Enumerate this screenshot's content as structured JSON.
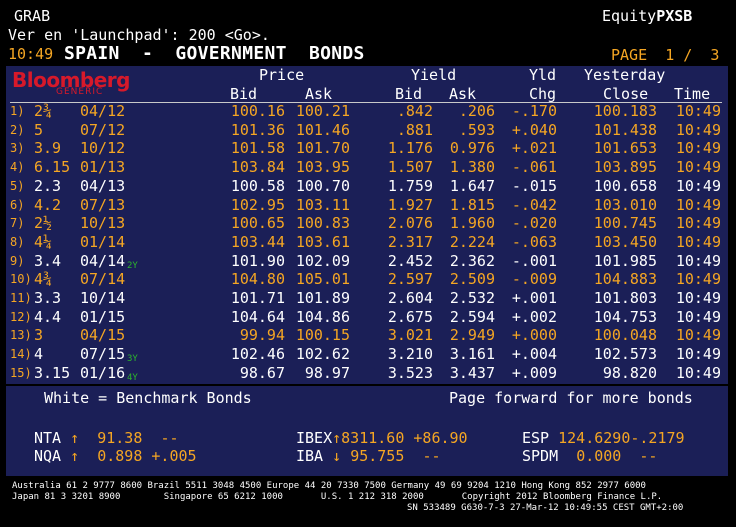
{
  "top": {
    "grab": "GRAB",
    "equity_prefix": "Equity",
    "equity_code": "PXSB",
    "command": "Ver en 'Launchpad': 200 <Go>."
  },
  "title_bar": {
    "time": "10:49",
    "title": "SPAIN  -  GOVERNMENT  BONDS",
    "page_label": "PAGE",
    "page_current": "1",
    "page_sep": "/",
    "page_total": "3"
  },
  "logo": {
    "brand": "Bloomberg",
    "sub": "GENERIC"
  },
  "headers": {
    "price": "Price",
    "yield": "Yield",
    "yld": "Yld",
    "yesterday": "Yesterday",
    "bid": "Bid",
    "ask": "Ask",
    "ybid": "Bid",
    "yask": "Ask",
    "chg": "Chg",
    "close": "Close",
    "time": "Time"
  },
  "rows": [
    {
      "n": "1)",
      "coupon": "2¾",
      "mat": "04/12",
      "tag": "",
      "pbid": "100.16",
      "pask": "100.21",
      "ybid": ".842",
      "yask": ".206",
      "chg": "-.170",
      "close": "100.183",
      "time": "10:49",
      "bench": false
    },
    {
      "n": "2)",
      "coupon": "5",
      "mat": "07/12",
      "tag": "",
      "pbid": "101.36",
      "pask": "101.46",
      "ybid": ".881",
      "yask": ".593",
      "chg": "+.040",
      "close": "101.438",
      "time": "10:49",
      "bench": false
    },
    {
      "n": "3)",
      "coupon": "3.9",
      "mat": "10/12",
      "tag": "",
      "pbid": "101.58",
      "pask": "101.70",
      "ybid": "1.176",
      "yask": "0.976",
      "chg": "+.021",
      "close": "101.653",
      "time": "10:49",
      "bench": false
    },
    {
      "n": "4)",
      "coupon": "6.15",
      "mat": "01/13",
      "tag": "",
      "pbid": "103.84",
      "pask": "103.95",
      "ybid": "1.507",
      "yask": "1.380",
      "chg": "-.061",
      "close": "103.895",
      "time": "10:49",
      "bench": false
    },
    {
      "n": "5)",
      "coupon": "2.3",
      "mat": "04/13",
      "tag": "",
      "pbid": "100.58",
      "pask": "100.70",
      "ybid": "1.759",
      "yask": "1.647",
      "chg": "-.015",
      "close": "100.658",
      "time": "10:49",
      "bench": true
    },
    {
      "n": "6)",
      "coupon": "4.2",
      "mat": "07/13",
      "tag": "",
      "pbid": "102.95",
      "pask": "103.11",
      "ybid": "1.927",
      "yask": "1.815",
      "chg": "-.042",
      "close": "103.010",
      "time": "10:49",
      "bench": false
    },
    {
      "n": "7)",
      "coupon": "2½",
      "mat": "10/13",
      "tag": "",
      "pbid": "100.65",
      "pask": "100.83",
      "ybid": "2.076",
      "yask": "1.960",
      "chg": "-.020",
      "close": "100.745",
      "time": "10:49",
      "bench": false
    },
    {
      "n": "8)",
      "coupon": "4¼",
      "mat": "01/14",
      "tag": "",
      "pbid": "103.44",
      "pask": "103.61",
      "ybid": "2.317",
      "yask": "2.224",
      "chg": "-.063",
      "close": "103.450",
      "time": "10:49",
      "bench": false
    },
    {
      "n": "9)",
      "coupon": "3.4",
      "mat": "04/14",
      "tag": "2Y",
      "pbid": "101.90",
      "pask": "102.09",
      "ybid": "2.452",
      "yask": "2.362",
      "chg": "-.001",
      "close": "101.985",
      "time": "10:49",
      "bench": true
    },
    {
      "n": "10)",
      "coupon": "4¾",
      "mat": "07/14",
      "tag": "",
      "pbid": "104.80",
      "pask": "105.01",
      "ybid": "2.597",
      "yask": "2.509",
      "chg": "-.009",
      "close": "104.883",
      "time": "10:49",
      "bench": false
    },
    {
      "n": "11)",
      "coupon": "3.3",
      "mat": "10/14",
      "tag": "",
      "pbid": "101.71",
      "pask": "101.89",
      "ybid": "2.604",
      "yask": "2.532",
      "chg": "+.001",
      "close": "101.803",
      "time": "10:49",
      "bench": true
    },
    {
      "n": "12)",
      "coupon": "4.4",
      "mat": "01/15",
      "tag": "",
      "pbid": "104.64",
      "pask": "104.86",
      "ybid": "2.675",
      "yask": "2.594",
      "chg": "+.002",
      "close": "104.753",
      "time": "10:49",
      "bench": true
    },
    {
      "n": "13)",
      "coupon": "3",
      "mat": "04/15",
      "tag": "",
      "pbid": "99.94",
      "pask": "100.15",
      "ybid": "3.021",
      "yask": "2.949",
      "chg": "+.000",
      "close": "100.048",
      "time": "10:49",
      "bench": false
    },
    {
      "n": "14)",
      "coupon": "4",
      "mat": "07/15",
      "tag": "3Y",
      "pbid": "102.46",
      "pask": "102.62",
      "ybid": "3.210",
      "yask": "3.161",
      "chg": "+.004",
      "close": "102.573",
      "time": "10:49",
      "bench": true
    },
    {
      "n": "15)",
      "coupon": "3.15",
      "mat": "01/16",
      "tag": "4Y",
      "pbid": "98.67",
      "pask": "98.97",
      "ybid": "3.523",
      "yask": "3.437",
      "chg": "+.009",
      "close": "98.820",
      "time": "10:49",
      "bench": true
    }
  ],
  "notes": {
    "benchmark": "White = Benchmark Bonds",
    "forward": "Page forward for more bonds"
  },
  "indices": {
    "nta_label": "NTA",
    "nta_arrow": "↑",
    "nta_val": "91.38",
    "nta_chg": "--",
    "nqa_label": "NQA",
    "nqa_arrow": "↑",
    "nqa_val": "0.898",
    "nqa_chg": "+.005",
    "ibex_label": "IBEX",
    "ibex_arrow": "↑",
    "ibex_val": "8311.60",
    "ibex_chg": "+86.90",
    "iba_label": "IBA",
    "iba_arrow": "↓",
    "iba_val": "95.755",
    "iba_chg": "--",
    "esp_label": "ESP",
    "esp_val": "124.6290-.2179",
    "spdm_label": "SPDM",
    "spdm_val": "0.000",
    "spdm_chg": "--"
  },
  "footer": {
    "line1": "Australia 61 2 9777 8600 Brazil 5511 3048 4500 Europe 44 20 7330 7500 Germany 49 69 9204 1210 Hong Kong 852 2977 6000",
    "line2": "Japan 81 3 3201 8900        Singapore 65 6212 1000       U.S. 1 212 318 2000       Copyright 2012 Bloomberg Finance L.P.",
    "line3": "SN 533489 G630-7-3 27-Mar-12 10:49:55 CEST GMT+2:00"
  },
  "colors": {
    "orange": "#f5a623",
    "panel": "#1b1f57",
    "logo_red": "#d7192a",
    "tag_green": "#2db52d"
  }
}
